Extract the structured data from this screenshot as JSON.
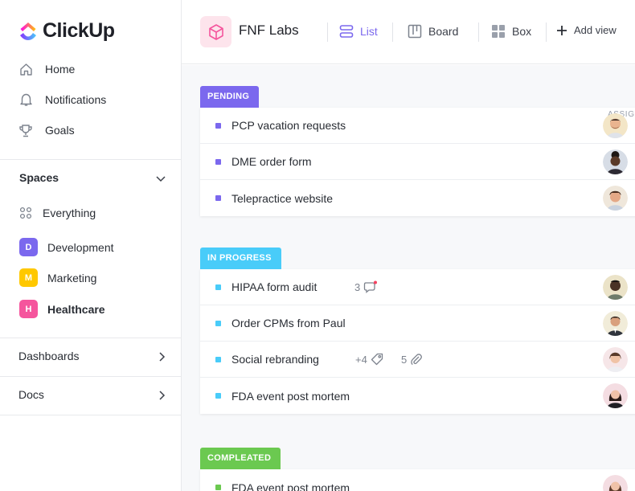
{
  "app": {
    "logo_text": "ClickUp",
    "brand_colors": [
      "#7b68ee",
      "#ff02f0",
      "#ffc800",
      "#49ccf9"
    ]
  },
  "sidebar": {
    "nav": [
      {
        "label": "Home",
        "icon": "home-icon"
      },
      {
        "label": "Notifications",
        "icon": "bell-icon"
      },
      {
        "label": "Goals",
        "icon": "trophy-icon"
      }
    ],
    "spaces_title": "Spaces",
    "everything_label": "Everything",
    "spaces": [
      {
        "letter": "D",
        "label": "Development",
        "color": "#7b68ee",
        "bold": false
      },
      {
        "letter": "M",
        "label": "Marketing",
        "color": "#ffc800",
        "bold": false
      },
      {
        "letter": "H",
        "label": "Healthcare",
        "color": "#f5559d",
        "bold": true
      }
    ],
    "dashboards_label": "Dashboards",
    "docs_label": "Docs"
  },
  "header": {
    "project_title": "FNF Labs",
    "views": [
      {
        "label": "List",
        "icon": "list-icon",
        "active": true
      },
      {
        "label": "Board",
        "icon": "board-icon",
        "active": false
      },
      {
        "label": "Box",
        "icon": "box-icon",
        "active": false
      }
    ],
    "add_view_label": "Add view"
  },
  "main": {
    "assignee_header": "ASSIGNEE",
    "groups": [
      {
        "label": "PENDING",
        "color": "#7b68ee",
        "tasks": [
          {
            "name": "PCP vacation requests"
          },
          {
            "name": "DME order form"
          },
          {
            "name": "Telepractice website"
          }
        ]
      },
      {
        "label": "IN PROGRESS",
        "color": "#49ccf9",
        "tasks": [
          {
            "name": "HIPAA form audit",
            "comments": "3"
          },
          {
            "name": "Order CPMs from Paul"
          },
          {
            "name": "Social rebranding",
            "tags": "+4",
            "attachments": "5"
          },
          {
            "name": "FDA event post mortem"
          }
        ]
      },
      {
        "label": "COMPLEATED",
        "color": "#6bc950",
        "tasks": [
          {
            "name": "FDA event post mortem"
          }
        ]
      }
    ]
  }
}
